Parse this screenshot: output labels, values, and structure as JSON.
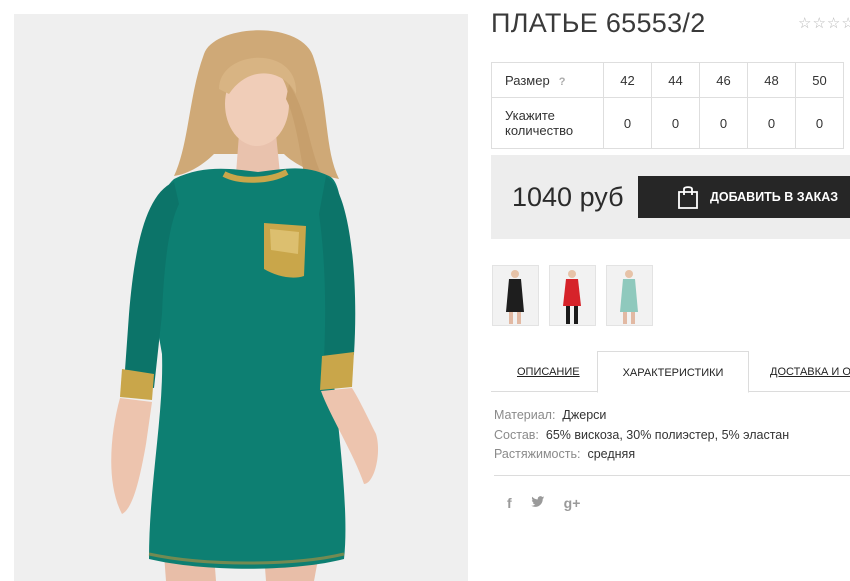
{
  "product": {
    "title": "ПЛАТЬЕ 65553/2",
    "rating_stars": "☆☆☆☆☆",
    "rating_value": 0
  },
  "size_table": {
    "size_label": "Размер",
    "help": "?",
    "sizes": [
      "42",
      "44",
      "46",
      "48",
      "50"
    ],
    "qty_label_line1": "Укажите",
    "qty_label_line2": "количество",
    "quantities": [
      "0",
      "0",
      "0",
      "0",
      "0"
    ]
  },
  "buy": {
    "price": "1040 руб",
    "add_label": "ДОБАВИТЬ В ЗАКАЗ",
    "button_color": "#262626"
  },
  "thumbnails": [
    {
      "name": "thumb-black-dress",
      "dress_color": "#1e1e1e"
    },
    {
      "name": "thumb-red-dress",
      "dress_color": "#d6232a"
    },
    {
      "name": "thumb-mint-dress",
      "dress_color": "#8fc9bd"
    }
  ],
  "tabs": [
    {
      "label": "ОПИСАНИЕ",
      "active": false
    },
    {
      "label": "ХАРАКТЕРИСТИКИ",
      "active": true
    },
    {
      "label": "ДОСТАВКА И ОПЛАТА",
      "active": false
    }
  ],
  "specs": [
    {
      "key": "Материал:",
      "value": "Джерси"
    },
    {
      "key": "Состав:",
      "value": "65% вискоза, 30% полиэстер, 5% эластан"
    },
    {
      "key": "Растяжимость:",
      "value": "средняя"
    }
  ],
  "social": {
    "facebook": "f",
    "twitter": "🐦",
    "googleplus": "g+"
  },
  "colors": {
    "dress_main": "#0d7f72",
    "gold_trim": "#c9a64a",
    "photo_bg": "#efefef"
  }
}
